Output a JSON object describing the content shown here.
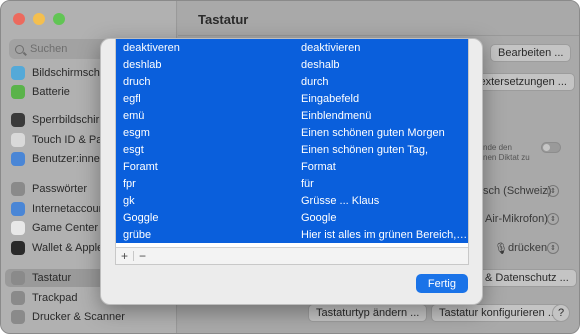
{
  "window": {
    "title": "Tastatur"
  },
  "sidebar": {
    "search_placeholder": "Suchen",
    "items": [
      {
        "label": "Bildschirmschoner",
        "color": "#54a9d8",
        "icon": "screensaver-icon"
      },
      {
        "label": "Batterie",
        "color": "#5ab34a",
        "icon": "battery-icon"
      },
      {
        "label": "Sperrbildschirm",
        "color": "#3a3a3a",
        "icon": "lock-icon"
      },
      {
        "label": "Touch ID & Passwort",
        "color": "#d9d9d9",
        "icon": "fingerprint-icon"
      },
      {
        "label": "Benutzer:innen & Gruppen",
        "color": "#4a86d6",
        "icon": "users-icon"
      },
      {
        "label": "Passwörter",
        "color": "#8a8a8a",
        "icon": "key-icon"
      },
      {
        "label": "Internetaccounts",
        "color": "#4a86d6",
        "icon": "at-icon"
      },
      {
        "label": "Game Center",
        "color": "#e8e8e8",
        "icon": "game-center-icon"
      },
      {
        "label": "Wallet & Apple Pay",
        "color": "#2a2a2a",
        "icon": "wallet-icon"
      },
      {
        "label": "Tastatur",
        "color": "#8a8a8a",
        "icon": "keyboard-icon"
      },
      {
        "label": "Trackpad",
        "color": "#8a8a8a",
        "icon": "trackpad-icon"
      },
      {
        "label": "Drucker & Scanner",
        "color": "#8a8a8a",
        "icon": "printer-icon"
      }
    ],
    "selected_index": 9
  },
  "background": {
    "edit_button": "Bearbeiten ...",
    "text_replacements_button": "Textersetzungen ...",
    "dictation_note_1": "nde den",
    "dictation_note_2": "nen Diktat zu",
    "language_popup": "sch (Schweiz)",
    "mic_popup": "Air-Mikrofon)",
    "shortcut_popup": "drücken",
    "privacy_button": "& Datenschutz ...",
    "keyboard_type_button": "Tastaturtyp ändern ...",
    "keyboard_config_button": "Tastatur konfigurieren ...",
    "help_button": "?"
  },
  "sheet": {
    "replacements": [
      {
        "replace": "deaktiveren",
        "with": "deaktivieren"
      },
      {
        "replace": "deshlab",
        "with": "deshalb"
      },
      {
        "replace": "druch",
        "with": "durch"
      },
      {
        "replace": "egfl",
        "with": "Eingabefeld"
      },
      {
        "replace": "emü",
        "with": "Einblendmenü"
      },
      {
        "replace": "esgm",
        "with": "Einen schönen guten Morgen"
      },
      {
        "replace": "esgt",
        "with": "Einen schönen guten Tag,"
      },
      {
        "replace": "Foramt",
        "with": "Format"
      },
      {
        "replace": "fpr",
        "with": "für"
      },
      {
        "replace": "gk",
        "with": "Grüsse ... Klaus"
      },
      {
        "replace": "Goggle",
        "with": "Google"
      },
      {
        "replace": "grübe",
        "with": "Hier ist alles im grünen Bereich, danke"
      }
    ],
    "add_label": "+",
    "remove_label": "−",
    "done_label": "Fertig",
    "selection_color": "#0a5fdc"
  }
}
